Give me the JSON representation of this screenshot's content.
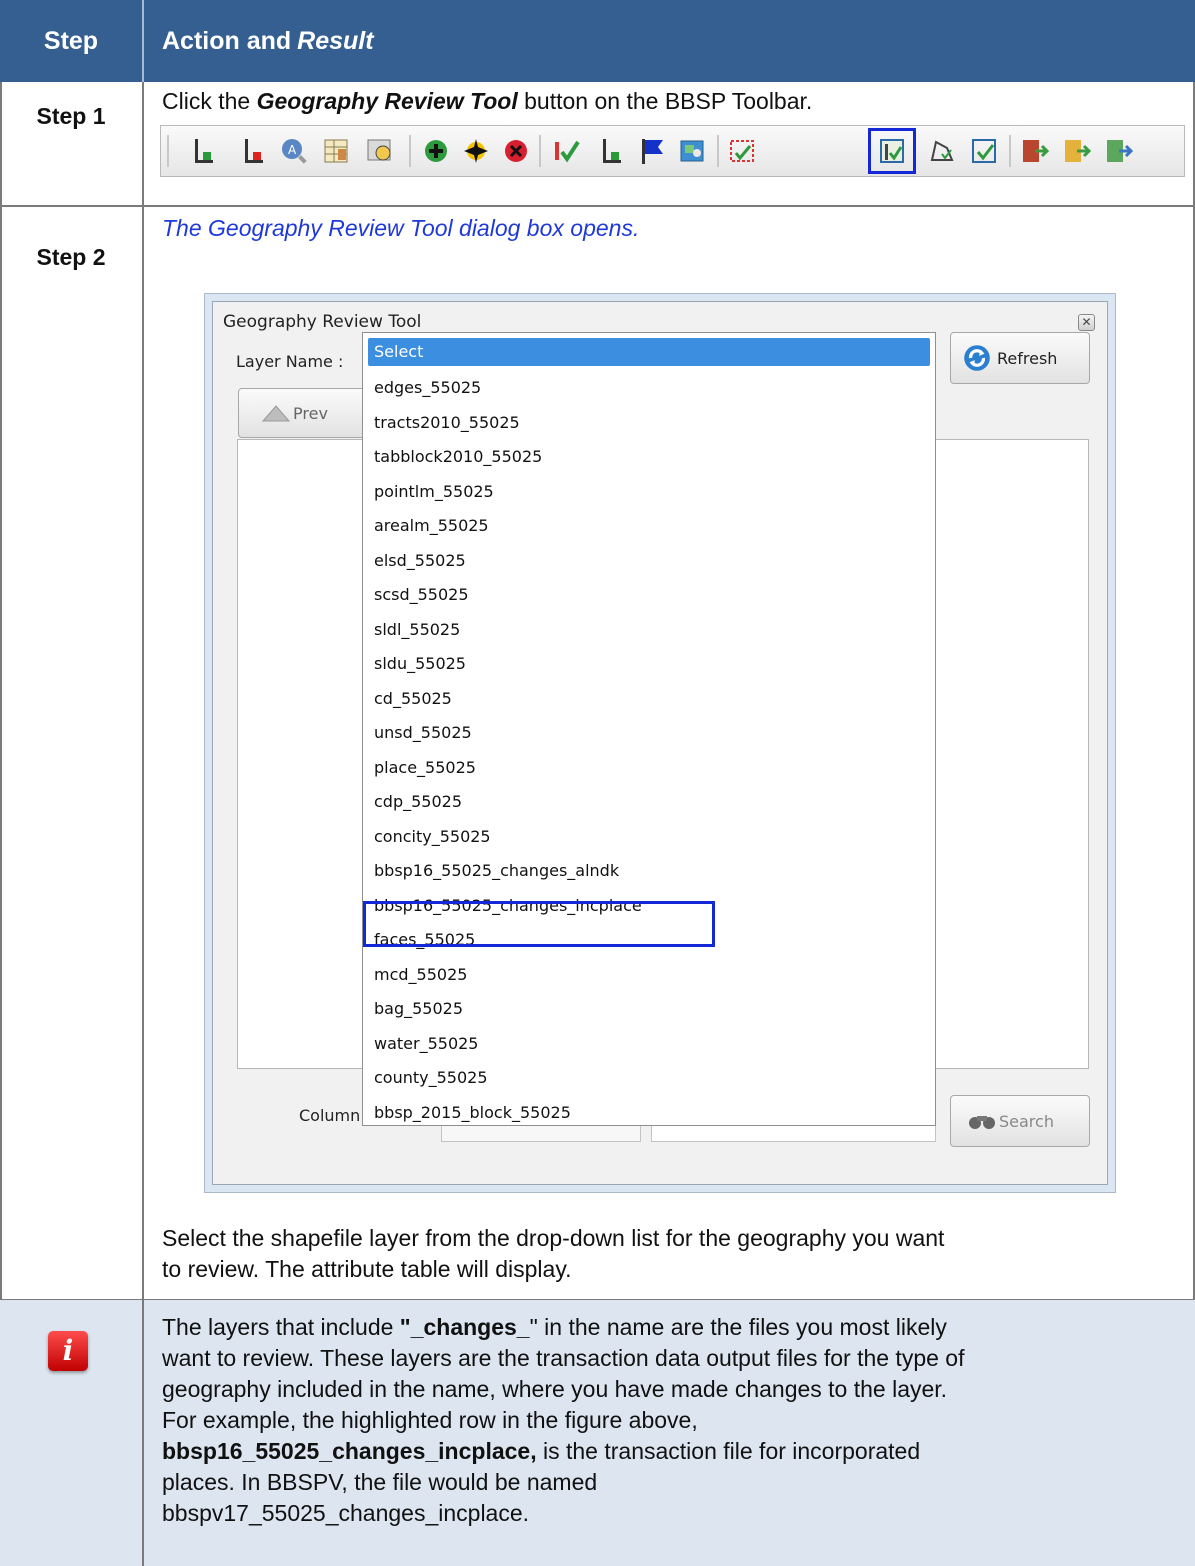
{
  "header": {
    "col_step": "Step",
    "col_action_prefix": "Action and ",
    "col_action_italic": "Result"
  },
  "step1": {
    "label": "Step 1",
    "text_before": "Click the ",
    "text_bold": "Geography Review Tool",
    "text_after": " button on the BBSP Toolbar."
  },
  "toolbar": {
    "icons": [
      "add-line-icon",
      "delete-line-icon",
      "zoom-to-icon",
      "attribute-table-icon",
      "search-layer-icon",
      "add-point-icon",
      "move-point-icon",
      "delete-point-icon",
      "review-check-icon",
      "add-line-2-icon",
      "flag-icon",
      "map-icon",
      "select-review-icon",
      "geography-review-icon",
      "polygon-edit-icon",
      "validate-icon",
      "export-icon",
      "export-2-icon",
      "export-3-icon"
    ],
    "highlight_color": "#1428d6"
  },
  "step2": {
    "label": "Step 2",
    "result": "The Geography Review Tool dialog box opens.",
    "instruction_line1": "Select the shapefile layer from the drop-down list for the geography you want",
    "instruction_line2": "to review. The attribute table will display."
  },
  "dialog": {
    "title": "Geography Review Tool",
    "layer_label": "Layer Name :",
    "refresh_label": "Refresh",
    "prev_label": "Prev",
    "column_label": "Column Name :",
    "search_label": "Search",
    "dropdown_selected": "Select",
    "dropdown_items": [
      "edges_55025",
      "tracts2010_55025",
      "tabblock2010_55025",
      "pointlm_55025",
      "arealm_55025",
      "elsd_55025",
      "scsd_55025",
      "sldl_55025",
      "sldu_55025",
      "cd_55025",
      "unsd_55025",
      "place_55025",
      "cdp_55025",
      "concity_55025",
      "bbsp16_55025_changes_alndk",
      "bbsp16_55025_changes_incplace",
      "faces_55025",
      "mcd_55025",
      "bag_55025",
      "water_55025",
      "county_55025",
      "bbsp_2015_block_55025"
    ],
    "highlighted_item": "bbsp16_55025_changes_incplace"
  },
  "note": {
    "l1_a": "The layers that include ",
    "l1_b": "\"_changes_",
    "l1_c": "\" in the name are the files you most likely",
    "l2": "want to review. These layers are the transaction data output files for the type of",
    "l3": "geography included in the name, where you have made changes to the layer.",
    "l4": "For example, the highlighted row in the figure above,",
    "l5_bold": "bbsp16_55025_changes_incplace,",
    "l5_rest": " is the transaction file for incorporated",
    "l6": "places.  In BBSPV, the file would be named",
    "l7": "bbspv17_55025_changes_incplace."
  },
  "colors": {
    "header_bg": "#355f91",
    "note_bg": "#dce5f0",
    "result_text": "#1f39d9"
  }
}
